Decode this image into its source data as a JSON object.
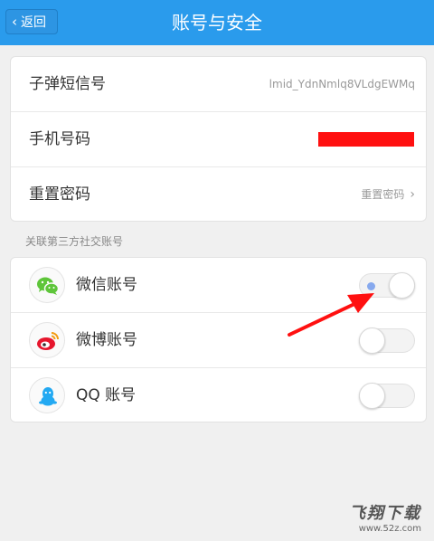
{
  "header": {
    "back_label": "返回",
    "title": "账号与安全"
  },
  "account": {
    "items": [
      {
        "label": "子弹短信号",
        "value": "lmid_YdnNmlq8VLdgEWMq"
      },
      {
        "label": "手机号码",
        "value": ""
      },
      {
        "label": "重置密码",
        "value": "重置密码"
      }
    ]
  },
  "social": {
    "section_title": "关联第三方社交账号",
    "items": [
      {
        "label": "微信账号",
        "icon": "wechat-icon",
        "enabled": true
      },
      {
        "label": "微博账号",
        "icon": "weibo-icon",
        "enabled": false
      },
      {
        "label": "QQ 账号",
        "icon": "qq-icon",
        "enabled": false
      }
    ]
  },
  "colors": {
    "header": "#2a9bec",
    "wechat": "#5ec53a",
    "weibo": "#e6162d",
    "qq": "#23a9f2",
    "annotation": "#ff1010"
  },
  "watermark": {
    "main": "飞翔下载",
    "sub": "www.52z.com"
  }
}
